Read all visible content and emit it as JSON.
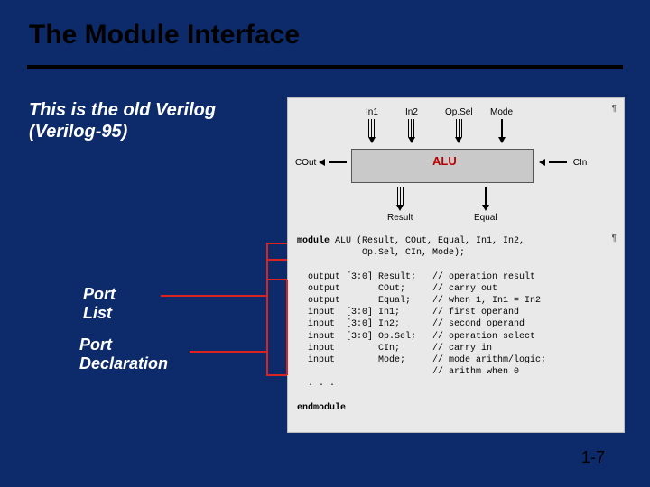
{
  "title": "The Module Interface",
  "subtitle_line1": "This is the old Verilog",
  "subtitle_line2": "(Verilog-95)",
  "label_port_list": "Port\nList",
  "label_port_decl": "Port\nDeclaration",
  "page_number": "1-7",
  "diagram": {
    "module_name": "ALU",
    "top_ports": [
      "In1",
      "In2",
      "Op.Sel",
      "Mode"
    ],
    "bottom_ports": [
      "Result",
      "Equal"
    ],
    "left_port": "COut",
    "right_port": "CIn"
  },
  "code": {
    "header": "module ALU (Result, COut, Equal, In1, In2,\n            Op.Sel, CIn, Mode);",
    "decls": [
      {
        "kw": "output",
        "range": "[3:0]",
        "name": "Result;",
        "comment": "// operation result"
      },
      {
        "kw": "output",
        "range": "",
        "name": "COut;",
        "comment": "// carry out"
      },
      {
        "kw": "output",
        "range": "",
        "name": "Equal;",
        "comment": "// when 1, In1 = In2"
      },
      {
        "kw": "input",
        "range": "[3:0]",
        "name": "In1;",
        "comment": "// first operand"
      },
      {
        "kw": "input",
        "range": "[3:0]",
        "name": "In2;",
        "comment": "// second operand"
      },
      {
        "kw": "input",
        "range": "[3:0]",
        "name": "Op.Sel;",
        "comment": "// operation select"
      },
      {
        "kw": "input",
        "range": "",
        "name": "CIn;",
        "comment": "// carry in"
      },
      {
        "kw": "input",
        "range": "",
        "name": "Mode;",
        "comment": "// mode arithm/logic;"
      }
    ],
    "trailing_comment": "// arithm when 0",
    "ellipsis": ". . .",
    "footer": "endmodule"
  }
}
